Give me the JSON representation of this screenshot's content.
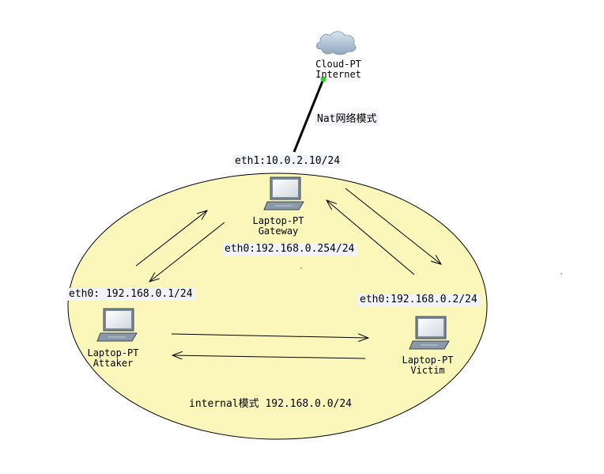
{
  "devices": {
    "cloud": {
      "type": "Cloud-PT",
      "name": "Internet"
    },
    "gateway": {
      "type": "Laptop-PT",
      "name": "Gateway"
    },
    "attacker": {
      "type": "Laptop-PT",
      "name": "Attaker"
    },
    "victim": {
      "type": "Laptop-PT",
      "name": "Victim"
    }
  },
  "labels": {
    "nat_mode": "Nat网络模式",
    "gateway_eth1": "eth1:10.0.2.10/24",
    "gateway_eth0": "eth0:192.168.0.254/24",
    "attacker_eth0": "eth0: 192.168.0.1/24",
    "victim_eth0": "eth0:192.168.0.2/24",
    "internal_network": "internal模式  192.168.0.0/24"
  },
  "colors": {
    "internal_zone_fill": "#fbf7bb",
    "link_color": "#000000",
    "link_status": "#33cc33",
    "label_bg": "#f1f3f7"
  },
  "icons": {
    "cloud": "cloud-icon",
    "laptop": "laptop-icon"
  }
}
